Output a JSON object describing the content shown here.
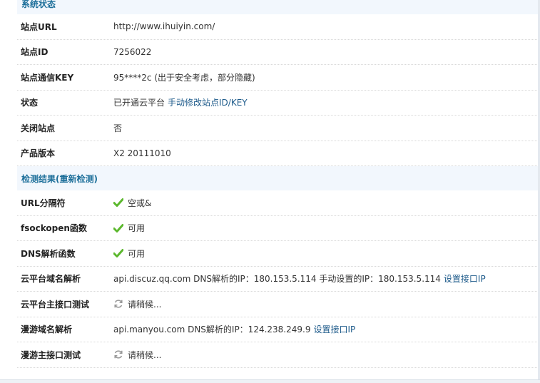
{
  "system_status": {
    "header": "系统状态",
    "rows": [
      {
        "label": "站点URL",
        "value": "http://www.ihuiyin.com/"
      },
      {
        "label": "站点ID",
        "value": "7256022"
      },
      {
        "label": "站点通信KEY",
        "value": "95****2c (出于安全考虑，部分隐藏)"
      },
      {
        "label": "状态",
        "value": "已开通云平台",
        "link": "手动修改站点ID/KEY"
      },
      {
        "label": "关闭站点",
        "value": "否"
      },
      {
        "label": "产品版本",
        "value": "X2 20111010"
      }
    ]
  },
  "detection": {
    "header": "检测结果",
    "recheck_link": "(重新检测)",
    "rows": [
      {
        "label": "URL分隔符",
        "icon": "check-icon",
        "value": "空或&"
      },
      {
        "label": "fsockopen函数",
        "icon": "check-icon",
        "value": "可用"
      },
      {
        "label": "DNS解析函数",
        "icon": "check-icon",
        "value": "可用"
      },
      {
        "label": "云平台域名解析",
        "value": "api.discuz.qq.com DNS解析的IP：180.153.5.114 手动设置的IP：180.153.5.114",
        "link": "设置接口IP"
      },
      {
        "label": "云平台主接口测试",
        "icon": "refresh-icon",
        "value": "请稍候..."
      },
      {
        "label": "漫游域名解析",
        "value": "api.manyou.com DNS解析的IP：124.238.249.9",
        "link": "设置接口IP"
      },
      {
        "label": "漫游主接口测试",
        "icon": "refresh-icon",
        "value": "请稍候..."
      }
    ]
  },
  "colors": {
    "header_bg": "#f2f7fd",
    "header_text": "#1d6f9a",
    "link": "#1d5a8a",
    "check": "#5cb82e"
  }
}
